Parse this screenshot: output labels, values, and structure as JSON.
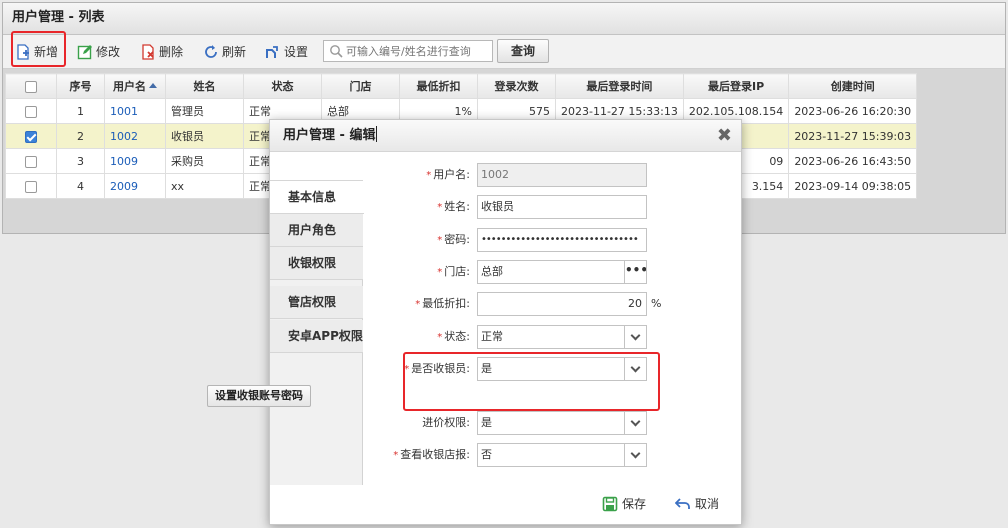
{
  "list": {
    "title": "用户管理 - 列表",
    "toolbar": {
      "new": "新增",
      "edit": "修改",
      "delete": "删除",
      "refresh": "刷新",
      "settings": "设置",
      "search_placeholder": "可输入编号/姓名进行查询",
      "search_button": "查询"
    },
    "columns": [
      "序号",
      "用户名",
      "姓名",
      "状态",
      "门店",
      "最低折扣",
      "登录次数",
      "最后登录时间",
      "最后登录IP",
      "创建时间"
    ],
    "rows": [
      {
        "checked": false,
        "index": "1",
        "username": "1001",
        "name": "管理员",
        "status": "正常",
        "store": "总部",
        "discount": "1%",
        "logins": "575",
        "last_login": "2023-11-27 15:33:13",
        "last_ip": "202.105.108.154",
        "created": "2023-06-26 16:20:30"
      },
      {
        "checked": true,
        "index": "2",
        "username": "1002",
        "name": "收银员",
        "status": "正常",
        "store": "",
        "discount": "",
        "logins": "",
        "last_login": "",
        "last_ip": "",
        "created": "2023-11-27 15:39:03"
      },
      {
        "checked": false,
        "index": "3",
        "username": "1009",
        "name": "采购员",
        "status": "正常",
        "store": "",
        "discount": "",
        "logins": "",
        "last_login": "",
        "last_ip": "09",
        "created": "2023-06-26 16:43:50"
      },
      {
        "checked": false,
        "index": "4",
        "username": "2009",
        "name": "xx",
        "status": "正常",
        "store": "",
        "discount": "",
        "logins": "",
        "last_login": "",
        "last_ip": "3.154",
        "created": "2023-09-14 09:38:05"
      }
    ]
  },
  "modal": {
    "title": "用户管理 - 编辑",
    "tabs": [
      "基本信息",
      "用户角色",
      "收银权限",
      "管店权限",
      "安卓APP权限"
    ],
    "fields": {
      "username": {
        "label": "用户名:",
        "value": "1002"
      },
      "name": {
        "label": "姓名:",
        "value": "收银员"
      },
      "password": {
        "label": "密码:",
        "value": "••••••••••••••••••••••••••••••••"
      },
      "store": {
        "label": "门店:",
        "value": "总部",
        "picker": "•••"
      },
      "min_discount": {
        "label": "最低折扣:",
        "value": "20",
        "unit": "%"
      },
      "status": {
        "label": "状态:",
        "value": "正常"
      },
      "is_cashier": {
        "label": "是否收银员:",
        "value": "是"
      },
      "purchase_price_perm": {
        "label": "进价权限:",
        "value": "是"
      },
      "view_cashier_report": {
        "label": "查看收银店报:",
        "value": "否"
      }
    },
    "required_mark": "*",
    "set_cashier_pwd_button": "设置收银账号密码",
    "footer": {
      "save": "保存",
      "cancel": "取消"
    },
    "close_glyph": "✖"
  },
  "colors": {
    "highlight": "#e8262a",
    "link": "#1b5db8",
    "selected_row": "#f4f3cb"
  }
}
